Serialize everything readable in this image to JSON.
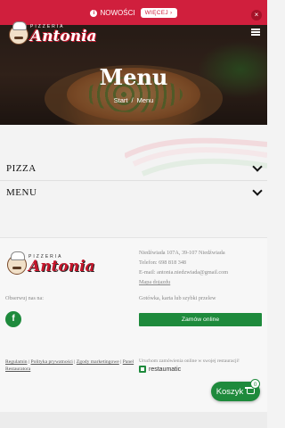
{
  "announcement": {
    "news_label": "NOWOŚCI",
    "more_label": "WIĘCEJ ›",
    "close_glyph": "×"
  },
  "brand": {
    "small": "PIZZERIA",
    "name": "Antonia"
  },
  "hero": {
    "title": "Menu",
    "breadcrumb": [
      "Start",
      "/",
      "Menu"
    ]
  },
  "categories": [
    {
      "label": "PIZZA"
    },
    {
      "label": "MENU"
    }
  ],
  "footer": {
    "address_line": "Niedźwiada 107A, 39-107 Niedźwiada",
    "phone": "Telefon: 698 818 348",
    "email": "E-mail: antonia.niedzwiada@gmail.com",
    "map_link": "Mapa dojazdu",
    "follow_label": "Obserwuj nas na:",
    "facebook_glyph": "f",
    "payment_label": "Gotówka, karta lub szybki przelew",
    "order_button": "Zamów online",
    "legal_links": [
      "Regulamin",
      "Polityka prywatności",
      "Zgody marketingowe",
      "Panel Restauratora"
    ],
    "restaumatic_note": "Uruchom zamówienia online w swojej restauracji!",
    "restaumatic_brand": "restaumatic"
  },
  "cart": {
    "label": "Koszyk",
    "count": "0"
  },
  "colors": {
    "accent_red": "#d01f3d",
    "accent_blue": "#3a5fa8",
    "accent_green": "#1e8a3c"
  },
  "icons": [
    "info-icon",
    "close-icon",
    "hamburger-icon",
    "chevron-down-icon",
    "facebook-icon",
    "restaumatic-logo-icon",
    "cart-icon"
  ]
}
